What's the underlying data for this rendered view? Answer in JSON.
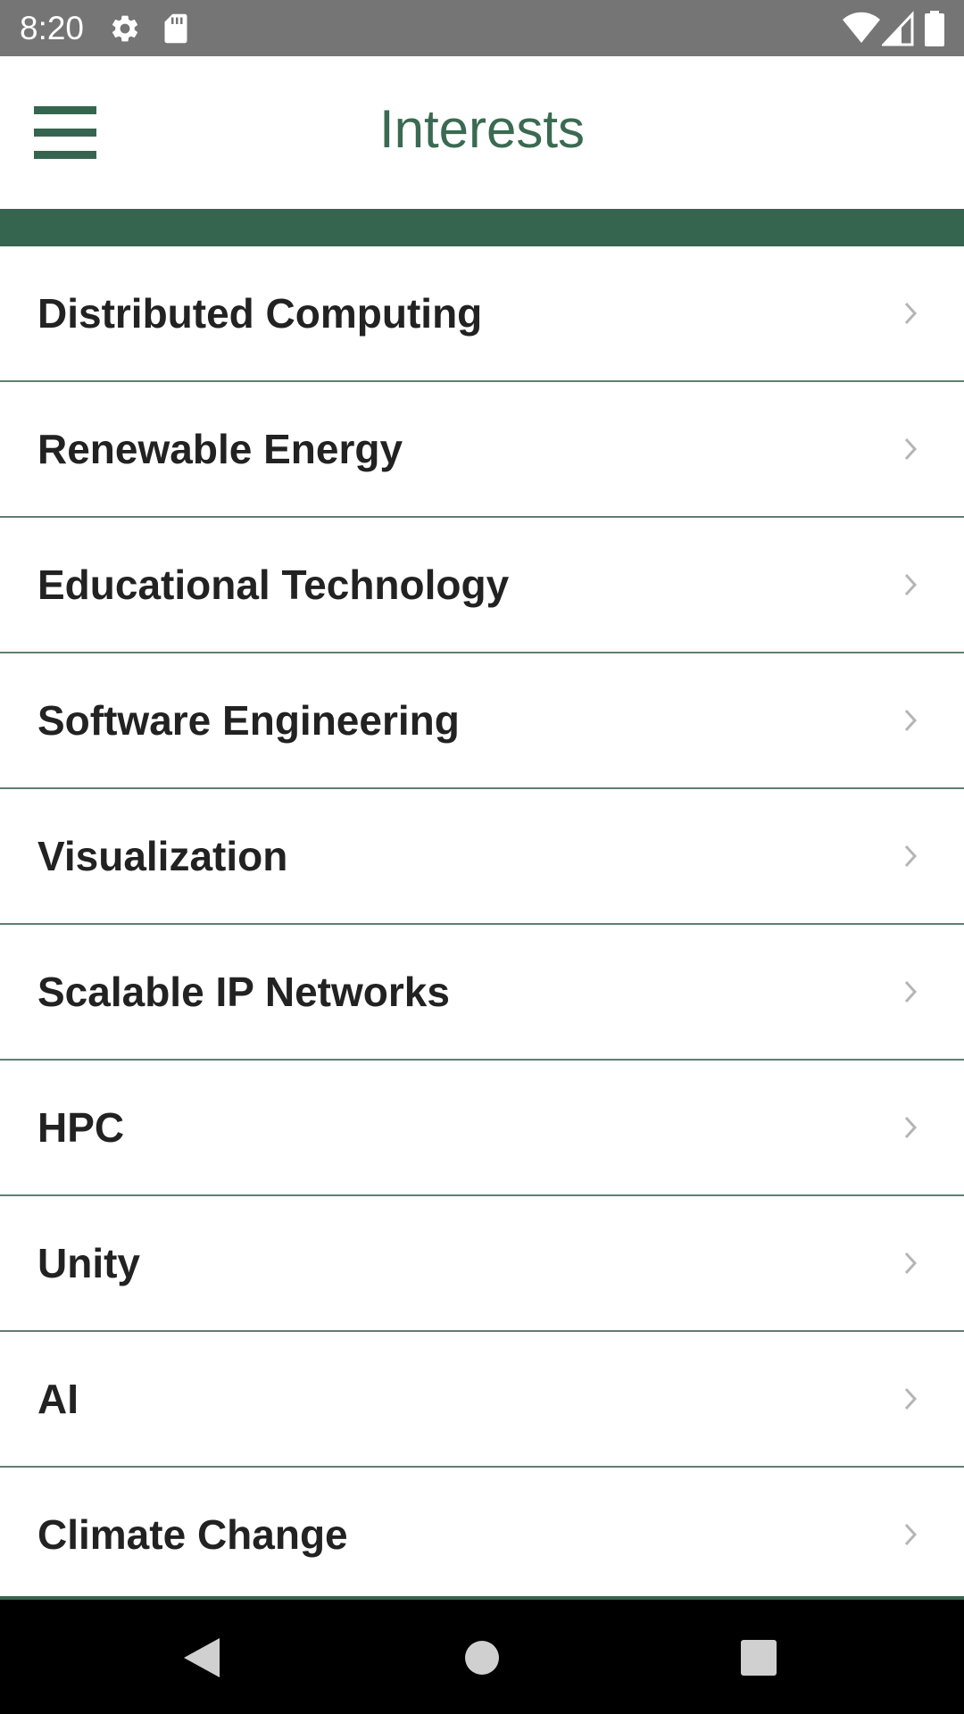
{
  "status_bar": {
    "time": "8:20",
    "icons": [
      "settings-icon",
      "sd-card-icon",
      "wifi-icon",
      "cell-signal-icon",
      "battery-icon"
    ]
  },
  "app_bar": {
    "title": "Interests",
    "menu_icon": "hamburger-menu-icon"
  },
  "colors": {
    "accent": "#36654f",
    "title": "#3a6a52",
    "status_bar": "#757575",
    "nav_bar": "#000000"
  },
  "interests": [
    {
      "label": "Distributed Computing"
    },
    {
      "label": "Renewable Energy"
    },
    {
      "label": "Educational Technology"
    },
    {
      "label": "Software Engineering"
    },
    {
      "label": "Visualization"
    },
    {
      "label": "Scalable IP Networks"
    },
    {
      "label": "HPC"
    },
    {
      "label": "Unity"
    },
    {
      "label": "AI"
    },
    {
      "label": "Climate Change"
    }
  ],
  "nav_bar": {
    "icons": [
      "back-icon",
      "home-icon",
      "recents-icon"
    ]
  }
}
